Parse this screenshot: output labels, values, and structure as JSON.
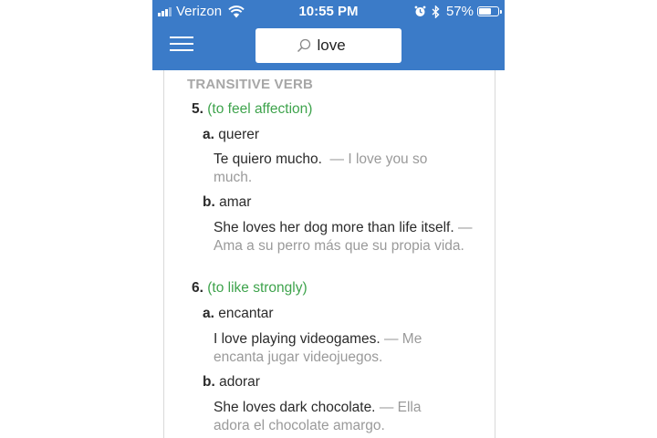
{
  "status_bar": {
    "carrier": "Verizon",
    "time": "10:55 PM",
    "battery_percent": "57%",
    "battery_level": 0.57,
    "icons": [
      "signal-icon",
      "wifi-icon",
      "alarm-icon",
      "bluetooth-icon",
      "battery-icon"
    ]
  },
  "nav": {
    "menu_icon": "hamburger-menu-icon",
    "search_value": "love",
    "search_icon": "search-icon"
  },
  "entry": {
    "part_of_speech": "TRANSITIVE VERB",
    "senses": [
      {
        "number": "5.",
        "gloss": "(to feel affection)",
        "subsenses": [
          {
            "letter": "a.",
            "translation": "querer",
            "example": "Te quiero mucho.",
            "example_translation": "— I love you so much."
          },
          {
            "letter": "b.",
            "translation": "amar",
            "example": "She loves her dog more than life itself.",
            "example_translation": "— Ama a su perro más que su propia vida."
          }
        ]
      },
      {
        "number": "6.",
        "gloss": "(to like strongly)",
        "subsenses": [
          {
            "letter": "a.",
            "translation": "encantar",
            "example": "I love playing videogames.",
            "example_translation": "— Me encanta jugar videojuegos."
          },
          {
            "letter": "b.",
            "translation": "adorar",
            "example": "She loves dark chocolate.",
            "example_translation": "— Ella adora el chocolate amargo."
          }
        ]
      }
    ]
  },
  "colors": {
    "header_blue": "#3b7bc8",
    "gloss_green": "#3ea34c",
    "muted_gray": "#9a9a9a",
    "label_gray": "#a7a7a7"
  }
}
